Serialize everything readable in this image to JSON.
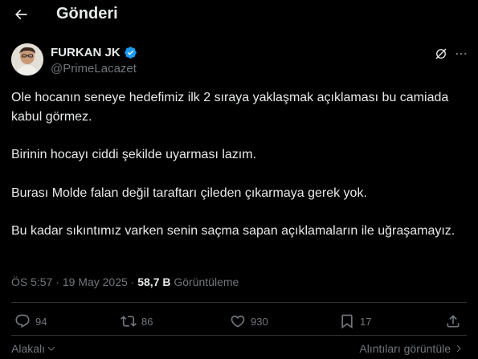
{
  "header": {
    "title": "Gönderi",
    "back_icon": "arrow-left-icon"
  },
  "author": {
    "display_name": "FURKAN JK",
    "handle": "@PrimeLacazet",
    "verified": true,
    "verified_color": "#1d9bf0"
  },
  "tweet": {
    "paragraphs": [
      "Ole hocanın seneye hedefimiz ilk 2 sıraya yaklaşmak açıklaması bu camiada kabul görmez.",
      "Birinin hocayı ciddi şekilde uyarması lazım.",
      "Burası Molde falan değil taraftarı çileden çıkarmaya gerek yok.",
      "Bu kadar sıkıntımız varken senin saçma sapan açıklamaların ile uğraşamayız."
    ]
  },
  "meta": {
    "time": "ÖS 5:57",
    "separator": "·",
    "date": "19 May 2025",
    "views_count": "58,7 B",
    "views_label": "Görüntüleme"
  },
  "actions": {
    "replies": "94",
    "reposts": "86",
    "likes": "930",
    "bookmarks": "17"
  },
  "footer": {
    "left_label": "Alakalı",
    "right_label": "Alıntıları görüntüle"
  },
  "colors": {
    "background": "#000000",
    "text": "#e7e9ea",
    "muted": "#71767b",
    "divider": "#2f3336"
  }
}
